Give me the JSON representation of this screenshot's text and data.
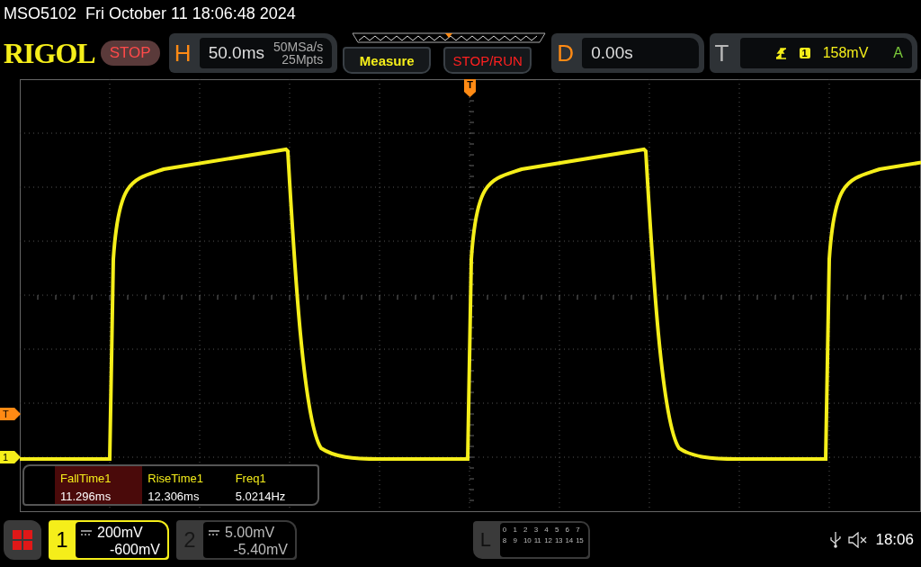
{
  "title_bar": {
    "text": "MSO5102  Fri October 11 18:06:48 2024"
  },
  "toolbar": {
    "logo": "RIGOL",
    "run_state": "STOP",
    "horizontal": {
      "label": "H",
      "timebase": "50.0ms",
      "sample_rate": "50MSa/s",
      "memory_depth": "25Mpts"
    },
    "buttons": [
      {
        "label": "Measure",
        "kind": "menu"
      },
      {
        "label": "STOP/RUN",
        "kind": "run"
      }
    ],
    "delay": {
      "label": "D",
      "value": "0.00s"
    },
    "trigger": {
      "label": "T",
      "source": "1",
      "level": "158mV",
      "mode": "A"
    }
  },
  "screen": {
    "trigger_marker": "T",
    "side_markers": [
      {
        "label": "T",
        "kind": "trigger"
      },
      {
        "label": "1",
        "kind": "channel"
      }
    ],
    "measurements": [
      {
        "name": "FallTime1",
        "value": "11.296ms",
        "selected": true
      },
      {
        "name": "RiseTime1",
        "value": "12.306ms",
        "selected": false
      },
      {
        "name": "Freq1",
        "value": "5.0214Hz",
        "selected": false
      }
    ]
  },
  "bottom_bar": {
    "channels": [
      {
        "number": "1",
        "scale": "200mV",
        "offset": "-600mV",
        "on": true
      },
      {
        "number": "2",
        "scale": "5.00mV",
        "offset": "-5.40mV",
        "on": false
      }
    ],
    "logic": {
      "label": "L",
      "rows": [
        [
          "0",
          "1",
          "2",
          "3",
          "4",
          "5",
          "6",
          "7"
        ],
        [
          "8",
          "9",
          "10",
          "11",
          "12",
          "13",
          "14",
          "15"
        ]
      ]
    },
    "time": "18:06"
  }
}
